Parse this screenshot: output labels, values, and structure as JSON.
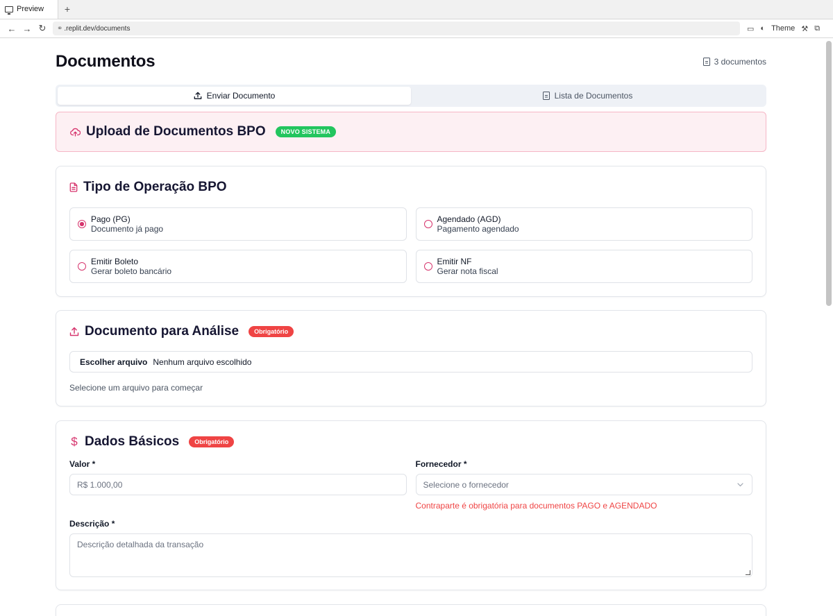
{
  "browser": {
    "tab_title": "Preview",
    "new_tab": "+",
    "url": ".replit.dev/documents",
    "theme_label": "Theme"
  },
  "header": {
    "title": "Documentos",
    "doc_count": "3 documentos"
  },
  "tabs": [
    {
      "label": "Enviar Documento",
      "icon": "upload-icon",
      "active": true
    },
    {
      "label": "Lista de Documentos",
      "icon": "document-icon",
      "active": false
    }
  ],
  "banner": {
    "title": "Upload de Documentos BPO",
    "badge": "NOVO SISTEMA"
  },
  "operation": {
    "title": "Tipo de Operação BPO",
    "options": [
      {
        "label": "Pago (PG)",
        "description": "Documento já pago",
        "checked": true
      },
      {
        "label": "Agendado (AGD)",
        "description": "Pagamento agendado",
        "checked": false
      },
      {
        "label": "Emitir Boleto",
        "description": "Gerar boleto bancário",
        "checked": false
      },
      {
        "label": "Emitir NF",
        "description": "Gerar nota fiscal",
        "checked": false
      }
    ]
  },
  "document": {
    "title": "Documento para Análise",
    "badge": "Obrigatório",
    "choose_label": "Escolher arquivo",
    "no_file": "Nenhum arquivo escolhido",
    "hint": "Selecione um arquivo para começar"
  },
  "basic": {
    "title": "Dados Básicos",
    "badge": "Obrigatório",
    "value_label": "Valor *",
    "value_placeholder": "R$ 1.000,00",
    "supplier_label": "Fornecedor *",
    "supplier_placeholder": "Selecione o fornecedor",
    "supplier_error": "Contraparte é obrigatória para documentos PAGO e AGENDADO",
    "description_label": "Descrição *",
    "description_placeholder": "Descrição detalhada da transação"
  },
  "colors": {
    "accent": "#d6336c",
    "success": "#22c55e",
    "danger": "#ef4444"
  }
}
